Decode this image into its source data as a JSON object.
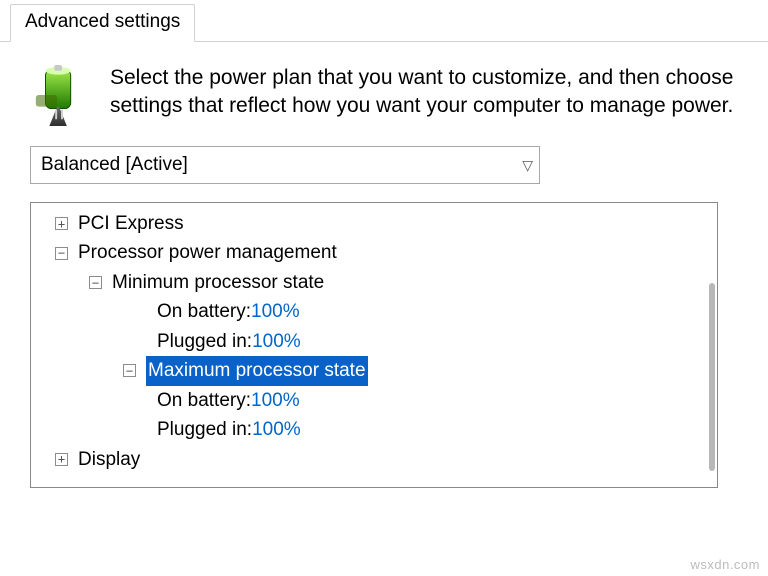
{
  "tab": {
    "label": "Advanced settings"
  },
  "intro": "Select the power plan that you want to customize, and then choose settings that reflect how you want your computer to manage power.",
  "plan_selected": "Balanced [Active]",
  "tree": {
    "pci_express": "PCI Express",
    "ppm": "Processor power management",
    "min_state": {
      "label": "Minimum processor state",
      "battery_label": "On battery",
      "battery_value": "100%",
      "plugged_label": "Plugged in",
      "plugged_value": "100%"
    },
    "max_state": {
      "label": "Maximum processor state",
      "battery_label": "On battery",
      "battery_value": "100%",
      "plugged_label": "Plugged in",
      "plugged_value": "100%"
    },
    "display": "Display"
  },
  "watermark": "wsxdn.com"
}
